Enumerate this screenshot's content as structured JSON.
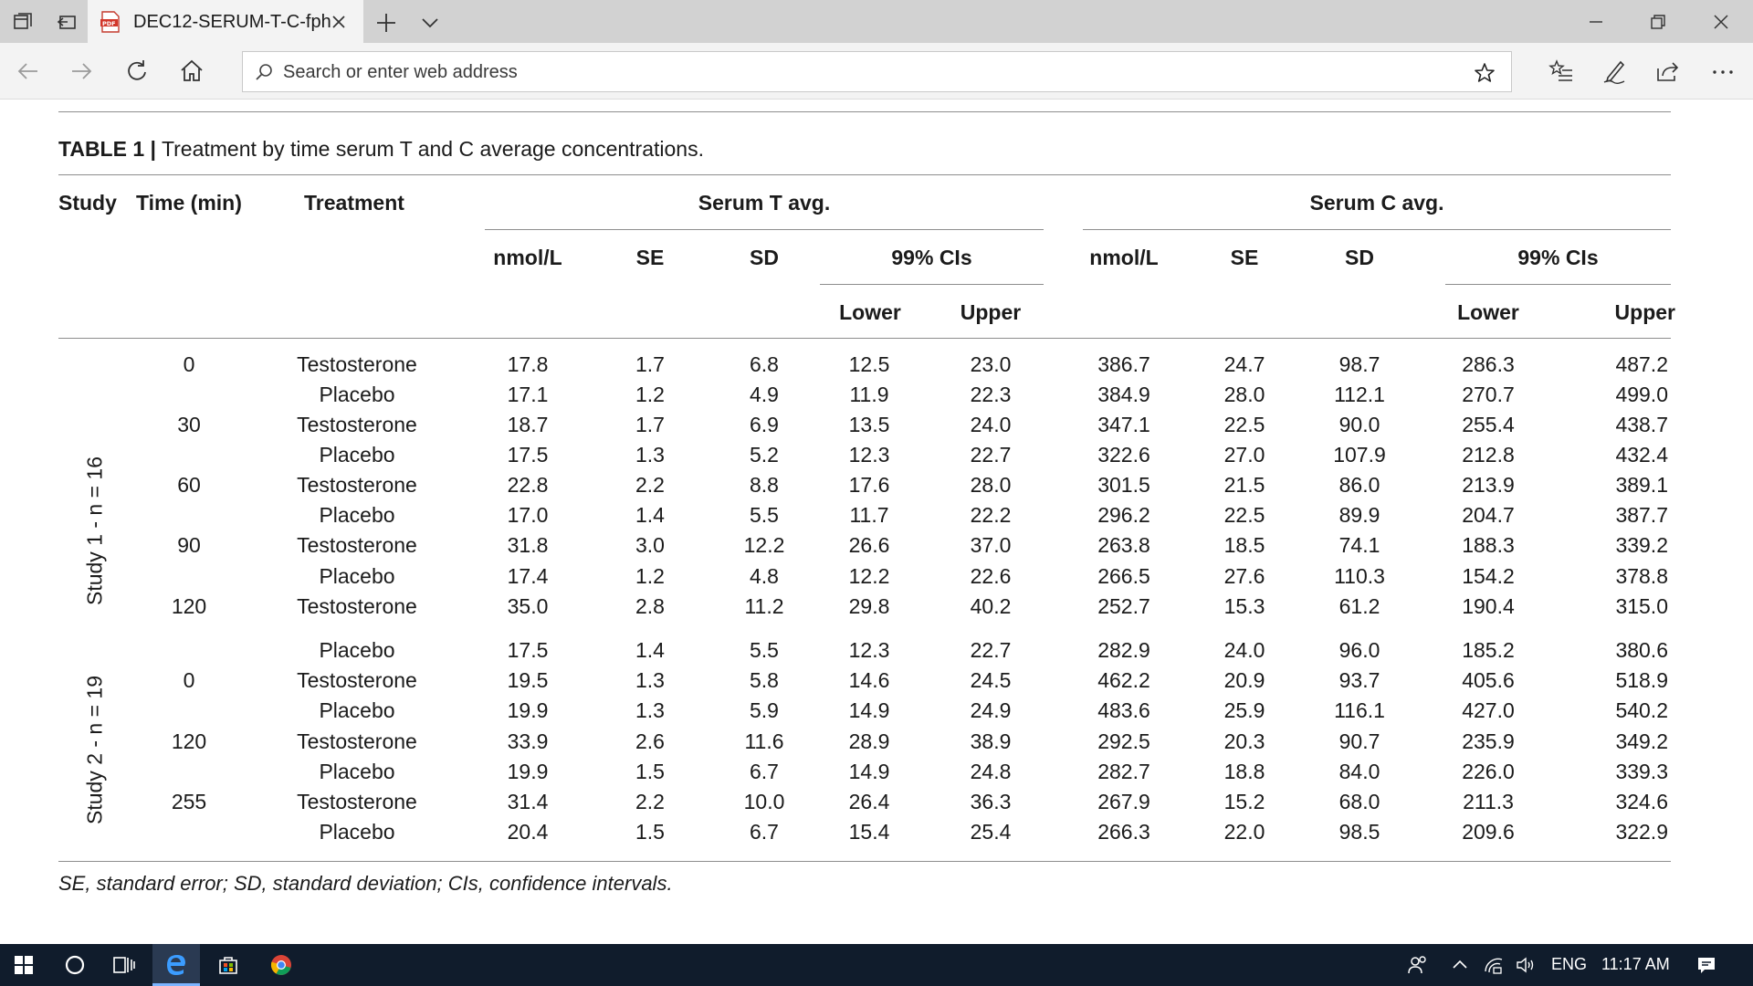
{
  "browser": {
    "tab_title": "DEC12-SERUM-T-C-fph",
    "address_placeholder": "Search or enter web address"
  },
  "table": {
    "title_bold": "TABLE 1 |",
    "title_rest": " Treatment by time serum T and C average concentrations.",
    "headers": {
      "study": "Study",
      "time": "Time (min)",
      "treatment": "Treatment",
      "serum_t": "Serum T avg.",
      "serum_c": "Serum C avg.",
      "nmol": "nmol/L",
      "se": "SE",
      "sd": "SD",
      "ci": "99% CIs",
      "lower": "Lower",
      "upper": "Upper"
    },
    "study_labels": [
      "Study 1 - n = 16",
      "Study 2 - n = 19"
    ],
    "rows": [
      [
        "0",
        "Testosterone",
        "17.8",
        "1.7",
        "6.8",
        "12.5",
        "23.0",
        "386.7",
        "24.7",
        "98.7",
        "286.3",
        "487.2"
      ],
      [
        "",
        "Placebo",
        "17.1",
        "1.2",
        "4.9",
        "11.9",
        "22.3",
        "384.9",
        "28.0",
        "112.1",
        "270.7",
        "499.0"
      ],
      [
        "30",
        "Testosterone",
        "18.7",
        "1.7",
        "6.9",
        "13.5",
        "24.0",
        "347.1",
        "22.5",
        "90.0",
        "255.4",
        "438.7"
      ],
      [
        "",
        "Placebo",
        "17.5",
        "1.3",
        "5.2",
        "12.3",
        "22.7",
        "322.6",
        "27.0",
        "107.9",
        "212.8",
        "432.4"
      ],
      [
        "60",
        "Testosterone",
        "22.8",
        "2.2",
        "8.8",
        "17.6",
        "28.0",
        "301.5",
        "21.5",
        "86.0",
        "213.9",
        "389.1"
      ],
      [
        "",
        "Placebo",
        "17.0",
        "1.4",
        "5.5",
        "11.7",
        "22.2",
        "296.2",
        "22.5",
        "89.9",
        "204.7",
        "387.7"
      ],
      [
        "90",
        "Testosterone",
        "31.8",
        "3.0",
        "12.2",
        "26.6",
        "37.0",
        "263.8",
        "18.5",
        "74.1",
        "188.3",
        "339.2"
      ],
      [
        "",
        "Placebo",
        "17.4",
        "1.2",
        "4.8",
        "12.2",
        "22.6",
        "266.5",
        "27.6",
        "110.3",
        "154.2",
        "378.8"
      ],
      [
        "120",
        "Testosterone",
        "35.0",
        "2.8",
        "11.2",
        "29.8",
        "40.2",
        "252.7",
        "15.3",
        "61.2",
        "190.4",
        "315.0"
      ],
      [
        "",
        "Placebo",
        "17.5",
        "1.4",
        "5.5",
        "12.3",
        "22.7",
        "282.9",
        "24.0",
        "96.0",
        "185.2",
        "380.6"
      ],
      [
        "0",
        "Testosterone",
        "19.5",
        "1.3",
        "5.8",
        "14.6",
        "24.5",
        "462.2",
        "20.9",
        "93.7",
        "405.6",
        "518.9"
      ],
      [
        "",
        "Placebo",
        "19.9",
        "1.3",
        "5.9",
        "14.9",
        "24.9",
        "483.6",
        "25.9",
        "116.1",
        "427.0",
        "540.2"
      ],
      [
        "120",
        "Testosterone",
        "33.9",
        "2.6",
        "11.6",
        "28.9",
        "38.9",
        "292.5",
        "20.3",
        "90.7",
        "235.9",
        "349.2"
      ],
      [
        "",
        "Placebo",
        "19.9",
        "1.5",
        "6.7",
        "14.9",
        "24.8",
        "282.7",
        "18.8",
        "84.0",
        "226.0",
        "339.3"
      ],
      [
        "255",
        "Testosterone",
        "31.4",
        "2.2",
        "10.0",
        "26.4",
        "36.3",
        "267.9",
        "15.2",
        "68.0",
        "211.3",
        "324.6"
      ],
      [
        "",
        "Placebo",
        "20.4",
        "1.5",
        "6.7",
        "15.4",
        "25.4",
        "266.3",
        "22.0",
        "98.5",
        "209.6",
        "322.9"
      ]
    ],
    "footnote": "SE, standard error; SD, standard deviation; CIs, confidence intervals."
  },
  "taskbar": {
    "language": "ENG",
    "time": "11:17 AM"
  },
  "colors": {
    "titlebar": "#d2d2d2",
    "tab_active": "#f3f3f3",
    "taskbar": "#101c2c",
    "rule": "#8d8d8d"
  }
}
